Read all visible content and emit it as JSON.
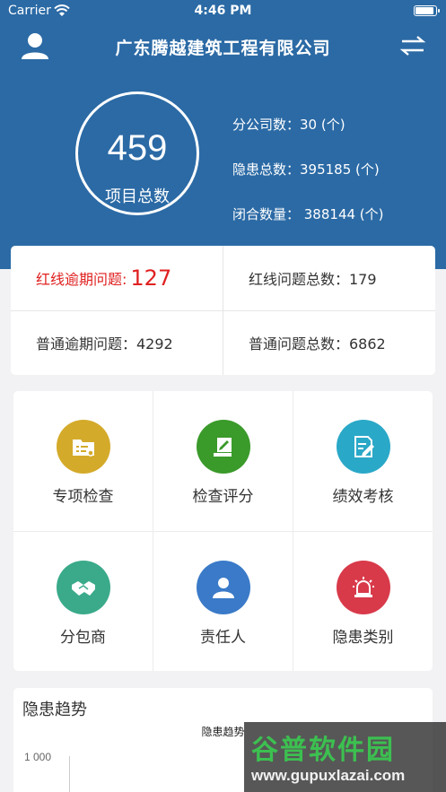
{
  "status_bar": {
    "carrier": "Carrier",
    "time": "4:46 PM"
  },
  "nav": {
    "title": "广东腾越建筑工程有限公司",
    "left_icon": "user-icon",
    "right_icon": "switch-icon"
  },
  "summary": {
    "total_projects": "459",
    "total_label": "项目总数",
    "branch_count": "分公司数：30 (个)",
    "hazard_total": "隐患总数：395185 (个)",
    "closed_count": "闭合数量： 388144 (个)"
  },
  "issues": {
    "redline_overdue_label": "红线逾期问题:",
    "redline_overdue_value": "127",
    "redline_total": "红线问题总数：179",
    "normal_overdue": "普通逾期问题：4292",
    "normal_total": "普通问题总数：6862"
  },
  "modules": [
    {
      "label": "专项检查",
      "icon": "folder-settings-icon",
      "color": "#d4aa2a"
    },
    {
      "label": "检查评分",
      "icon": "scroll-pen-icon",
      "color": "#3a9a2a"
    },
    {
      "label": "绩效考核",
      "icon": "document-edit-icon",
      "color": "#2aa8c8"
    },
    {
      "label": "分包商",
      "icon": "handshake-icon",
      "color": "#3aaa8a"
    },
    {
      "label": "责任人",
      "icon": "person-icon",
      "color": "#3a7ac8"
    },
    {
      "label": "隐患类别",
      "icon": "alarm-icon",
      "color": "#d83a4a"
    }
  ],
  "trend": {
    "section_title": "隐患趋势",
    "chart_title": "隐患趋势",
    "y_tick": "1 000"
  },
  "watermark": {
    "brand": "谷普软件园",
    "url": "www.gupuxlazai.com"
  },
  "colors": {
    "header_bg": "#2b6aa5",
    "alert_red": "#e02020"
  }
}
